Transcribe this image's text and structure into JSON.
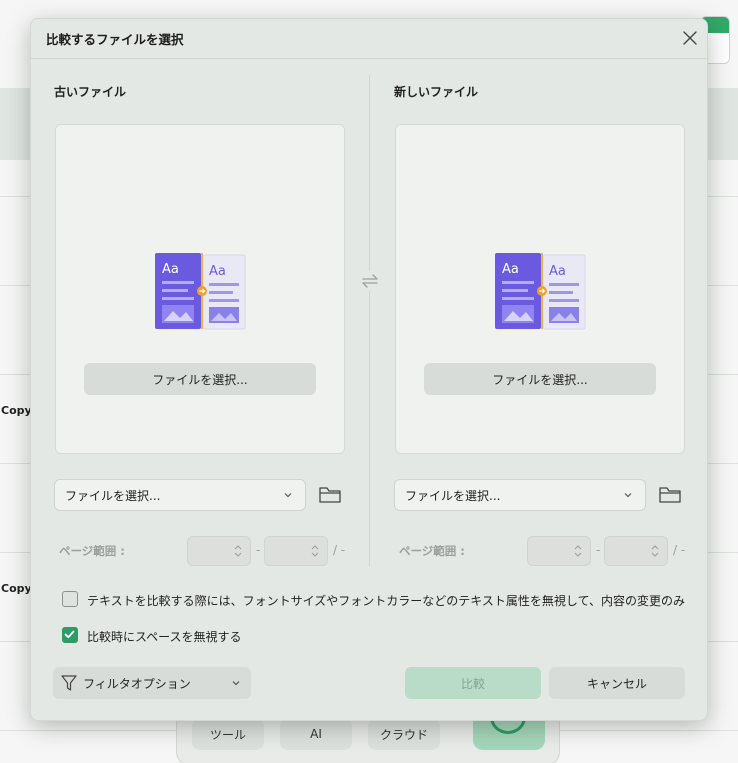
{
  "dialog": {
    "title": "比較するファイルを選択",
    "old_file": {
      "heading": "古いファイル",
      "pick_button": "ファイルを選択...",
      "select_value": "ファイルを選択...",
      "page_range_label": "ページ範囲 :",
      "range_dash": "-",
      "range_total": "/ -"
    },
    "new_file": {
      "heading": "新しいファイル",
      "pick_button": "ファイルを選択...",
      "select_value": "ファイルを選択...",
      "page_range_label": "ページ範囲 :",
      "range_dash": "-",
      "range_total": "/ -"
    },
    "options": {
      "ignore_format_label": "テキストを比較する際には、フォントサイズやフォントカラーなどのテキスト属性を無視して、内容の変更のみ",
      "ignore_format_checked": false,
      "ignore_spaces_label": "比較時にスペースを無視する",
      "ignore_spaces_checked": true
    },
    "filter_button": "フィルタオプション",
    "compare_button": "比較",
    "cancel_button": "キャンセル"
  },
  "background": {
    "copy_labels": [
      "Copy",
      "Copy"
    ],
    "dock": [
      "ツール",
      "AI",
      "クラウド"
    ]
  },
  "colors": {
    "accent": "#2e9a66",
    "compare_disabled": "#b8dcc8",
    "illustration_purple": "#6a5ae0"
  },
  "icons": [
    "close-icon",
    "swap-icon",
    "folder-icon",
    "chevron-down-icon",
    "filter-icon",
    "spin-updown-icon",
    "checkmark-icon"
  ]
}
